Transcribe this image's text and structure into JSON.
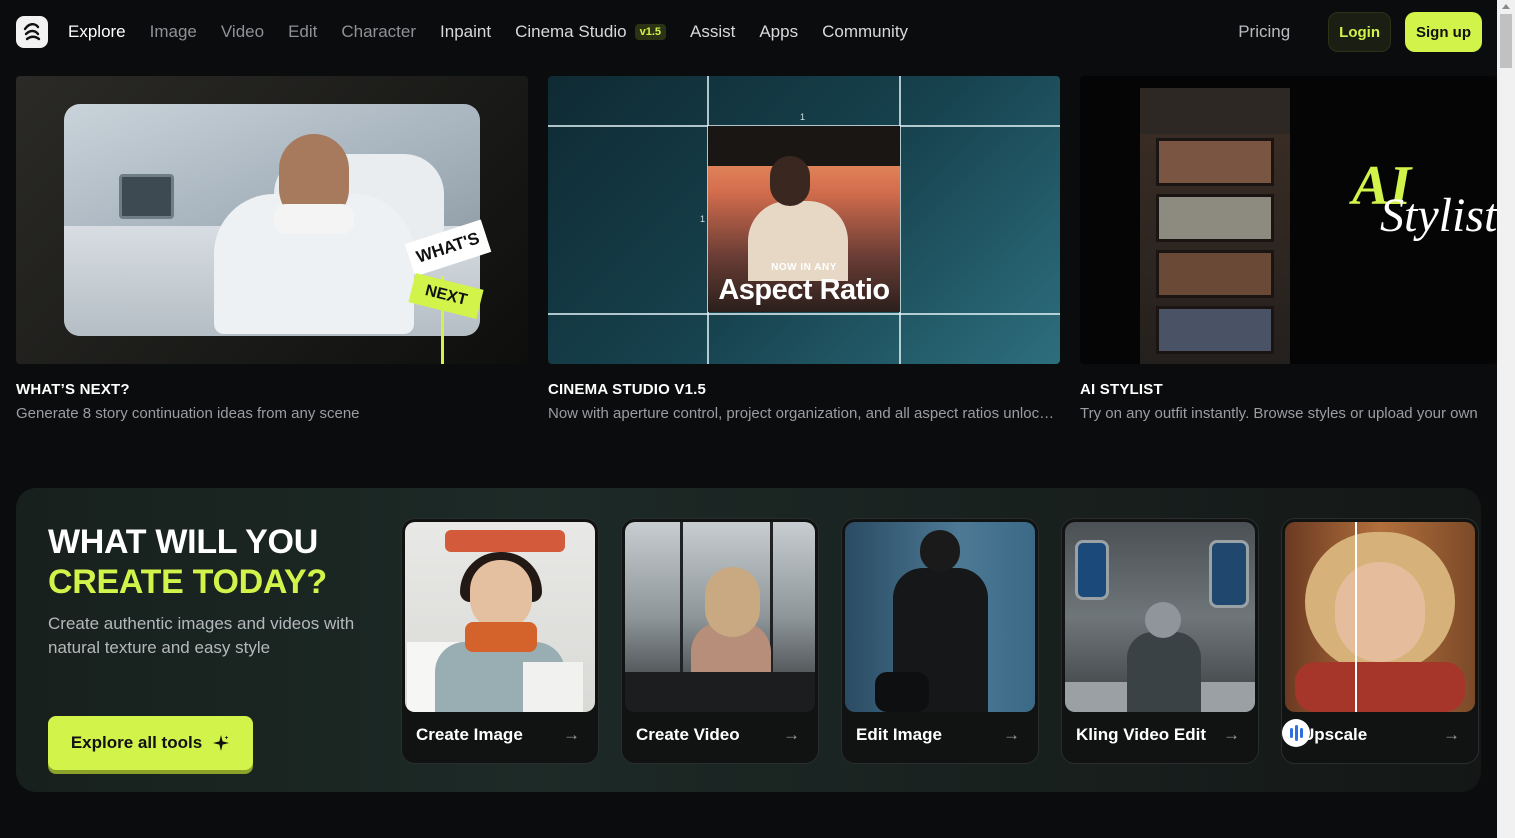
{
  "nav": {
    "items": [
      {
        "label": "Explore",
        "state": "active"
      },
      {
        "label": "Image",
        "state": "dim"
      },
      {
        "label": "Video",
        "state": "dim"
      },
      {
        "label": "Edit",
        "state": "dim"
      },
      {
        "label": "Character",
        "state": "dim"
      },
      {
        "label": "Inpaint",
        "state": "bright"
      },
      {
        "label": "Cinema Studio",
        "state": "bright",
        "badge": "v1.5"
      },
      {
        "label": "Assist",
        "state": "bright"
      },
      {
        "label": "Apps",
        "state": "bright"
      },
      {
        "label": "Community",
        "state": "bright"
      }
    ],
    "pricing": "Pricing",
    "login": "Login",
    "signup": "Sign up"
  },
  "features": [
    {
      "title": "WHAT’S NEXT?",
      "desc": "Generate 8 story continuation ideas from any scene",
      "sign1": "WHAT'S",
      "sign2": "NEXT"
    },
    {
      "title": "CINEMA STUDIO V1.5",
      "desc": "Now with aperture control, project organization, and all aspect ratios unlocked",
      "overlay_small": "NOW IN ANY",
      "overlay_large": "Aspect Ratio",
      "tick1": "1",
      "tick2": "1"
    },
    {
      "title": "AI STYLIST",
      "desc": "Try on any outfit instantly. Browse styles or upload your own",
      "overlay_ai": "AI",
      "overlay_stylist": "Stylist"
    }
  ],
  "cta": {
    "heading_line1": "WHAT WILL YOU",
    "heading_line2": "CREATE TODAY?",
    "subtitle": "Create authentic images and videos with natural texture and easy style",
    "button": "Explore all tools"
  },
  "tools": [
    {
      "label": "Create Image"
    },
    {
      "label": "Create Video"
    },
    {
      "label": "Edit Image"
    },
    {
      "label": "Kling Video Edit"
    },
    {
      "label": "Upscale"
    }
  ],
  "colors": {
    "accent": "#d2f34a",
    "background": "#0b0c0d"
  },
  "icons": {
    "logo": "brand-logo-icon",
    "arrow": "arrow-right-icon",
    "sparkle": "sparkle-icon"
  }
}
